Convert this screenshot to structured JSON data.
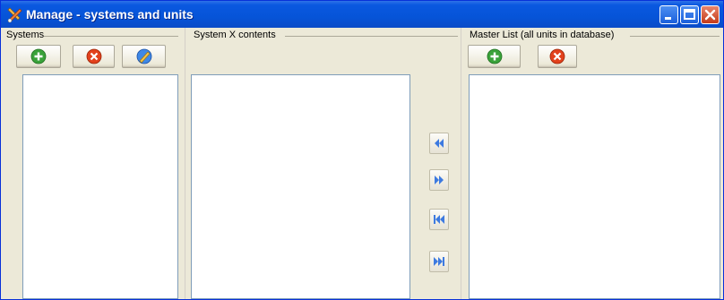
{
  "window": {
    "title": "Manage - systems and units"
  },
  "systems": {
    "label": "Systems",
    "buttons": [
      "add-icon",
      "remove-icon",
      "edit-icon"
    ]
  },
  "contents": {
    "label": "System X contents"
  },
  "transfer": {
    "buttons": [
      "move-left-icon",
      "move-right-icon",
      "move-all-left-icon",
      "move-all-right-icon"
    ]
  },
  "master": {
    "label": "Master List (all units in database)",
    "buttons": [
      "add-icon",
      "remove-icon"
    ]
  },
  "colors": {
    "titlebar": "#0a58e0",
    "accent_green": "#3aa23a",
    "accent_red": "#e2411c",
    "transfer_arrow": "#3d7ae0"
  }
}
